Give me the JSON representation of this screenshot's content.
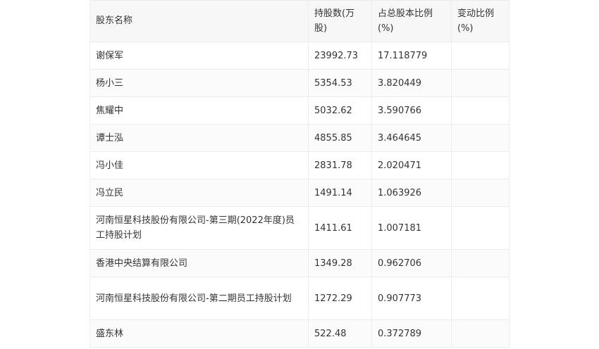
{
  "table": {
    "headers": [
      "股东名称",
      "持股数(万股)",
      "占总股本比例(%)",
      "变动比例(%)"
    ],
    "rows": [
      {
        "name": "谢保军",
        "shares": "23992.73",
        "ratio": "17.118779",
        "change": ""
      },
      {
        "name": "杨小三",
        "shares": "5354.53",
        "ratio": "3.820449",
        "change": ""
      },
      {
        "name": "焦耀中",
        "shares": "5032.62",
        "ratio": "3.590766",
        "change": ""
      },
      {
        "name": "谭士泓",
        "shares": "4855.85",
        "ratio": "3.464645",
        "change": ""
      },
      {
        "name": "冯小佳",
        "shares": "2831.78",
        "ratio": "2.020471",
        "change": ""
      },
      {
        "name": "冯立民",
        "shares": "1491.14",
        "ratio": "1.063926",
        "change": ""
      },
      {
        "name": "河南恒星科技股份有限公司-第三期(2022年度)员工持股计划",
        "shares": "1411.61",
        "ratio": "1.007181",
        "change": ""
      },
      {
        "name": "香港中央结算有限公司",
        "shares": "1349.28",
        "ratio": "0.962706",
        "change": ""
      },
      {
        "name": "河南恒星科技股份有限公司-第二期员工持股计划",
        "shares": "1272.29",
        "ratio": "0.907773",
        "change": ""
      },
      {
        "name": "盛东林",
        "shares": "522.48",
        "ratio": "0.372789",
        "change": ""
      }
    ]
  }
}
